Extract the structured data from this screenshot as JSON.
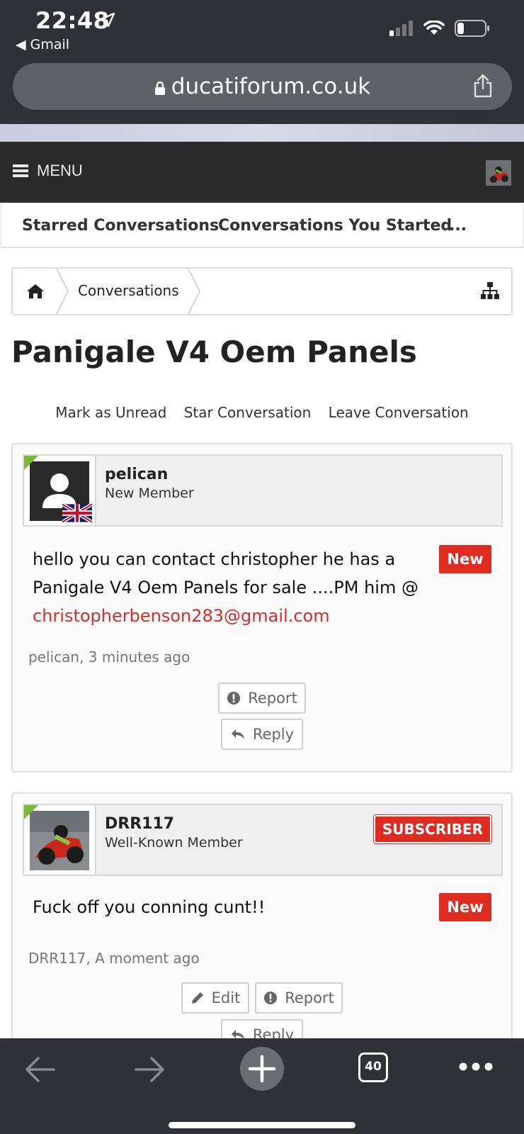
{
  "status_bar": {
    "time": "22:48",
    "back_app": "◀ Gmail"
  },
  "browser": {
    "url": "ducatiforum.co.uk",
    "tab_count": "40"
  },
  "header": {
    "menu_label": "MENU"
  },
  "subnav": {
    "tabs": [
      "Starred Conversations",
      "Conversations You Started",
      "..."
    ]
  },
  "breadcrumb": {
    "items": [
      "Conversations"
    ]
  },
  "page": {
    "title": "Panigale V4 Oem Panels"
  },
  "actions": [
    "Mark as Unread",
    "Star Conversation",
    "Leave Conversation"
  ],
  "messages": [
    {
      "username": "pelican",
      "user_title": "New Member",
      "badge": "New",
      "body_lines": [
        "hello you can contact christopher he has a",
        "Panigale V4 Oem Panels for sale ....PM him @"
      ],
      "email": "christopherbenson283@gmail.com",
      "meta": "pelican, 3 minutes ago",
      "buttons": {
        "report": "Report",
        "reply": "Reply"
      }
    },
    {
      "username": "DRR117",
      "user_title": "Well-Known Member",
      "user_badge": "SUBSCRIBER",
      "badge": "New",
      "body": "Fuck off you conning cunt!!",
      "meta": "DRR117, A moment ago",
      "buttons": {
        "edit": "Edit",
        "report": "Report",
        "reply": "Reply"
      }
    }
  ],
  "icons": [
    "location-arrow-icon",
    "signal-icon",
    "wifi-icon",
    "battery-icon",
    "lock-icon",
    "share-icon",
    "hamburger-icon",
    "home-icon",
    "sitemap-icon",
    "uk-flag-icon",
    "exclamation-circle-icon",
    "reply-arrow-icon",
    "pencil-icon",
    "back-arrow-icon",
    "forward-arrow-icon",
    "plus-icon",
    "tabs-icon",
    "more-icon"
  ],
  "colors": {
    "accent_red": "#e02b20",
    "email_red": "#d32f2f",
    "online_green": "#7ab82e",
    "header_dark": "#2b2b2b",
    "ios_bar": "#2f3136"
  }
}
